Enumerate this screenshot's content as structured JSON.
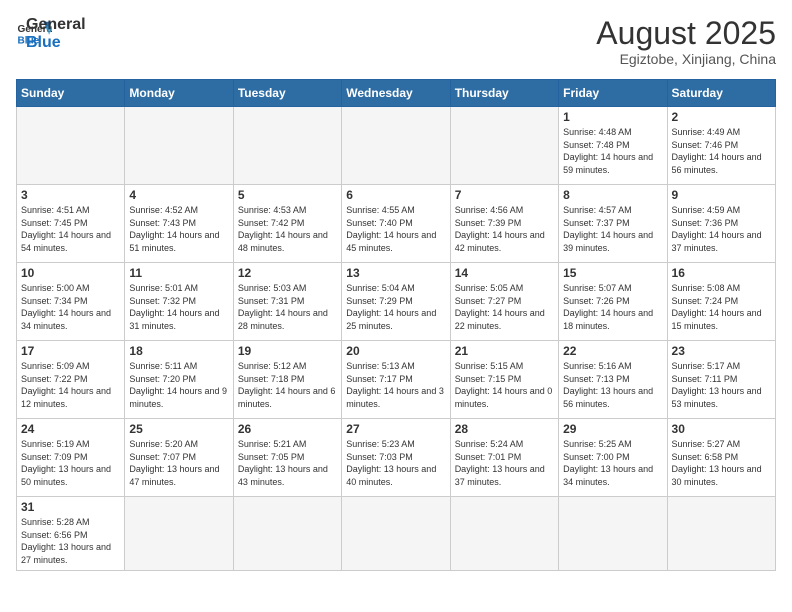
{
  "header": {
    "logo_general": "General",
    "logo_blue": "Blue",
    "title": "August 2025",
    "subtitle": "Egiztobe, Xinjiang, China"
  },
  "weekdays": [
    "Sunday",
    "Monday",
    "Tuesday",
    "Wednesday",
    "Thursday",
    "Friday",
    "Saturday"
  ],
  "weeks": [
    [
      {
        "day": "",
        "info": "",
        "empty": true
      },
      {
        "day": "",
        "info": "",
        "empty": true
      },
      {
        "day": "",
        "info": "",
        "empty": true
      },
      {
        "day": "",
        "info": "",
        "empty": true
      },
      {
        "day": "",
        "info": "",
        "empty": true
      },
      {
        "day": "1",
        "info": "Sunrise: 4:48 AM\nSunset: 7:48 PM\nDaylight: 14 hours and 59 minutes."
      },
      {
        "day": "2",
        "info": "Sunrise: 4:49 AM\nSunset: 7:46 PM\nDaylight: 14 hours and 56 minutes."
      }
    ],
    [
      {
        "day": "3",
        "info": "Sunrise: 4:51 AM\nSunset: 7:45 PM\nDaylight: 14 hours and 54 minutes."
      },
      {
        "day": "4",
        "info": "Sunrise: 4:52 AM\nSunset: 7:43 PM\nDaylight: 14 hours and 51 minutes."
      },
      {
        "day": "5",
        "info": "Sunrise: 4:53 AM\nSunset: 7:42 PM\nDaylight: 14 hours and 48 minutes."
      },
      {
        "day": "6",
        "info": "Sunrise: 4:55 AM\nSunset: 7:40 PM\nDaylight: 14 hours and 45 minutes."
      },
      {
        "day": "7",
        "info": "Sunrise: 4:56 AM\nSunset: 7:39 PM\nDaylight: 14 hours and 42 minutes."
      },
      {
        "day": "8",
        "info": "Sunrise: 4:57 AM\nSunset: 7:37 PM\nDaylight: 14 hours and 39 minutes."
      },
      {
        "day": "9",
        "info": "Sunrise: 4:59 AM\nSunset: 7:36 PM\nDaylight: 14 hours and 37 minutes."
      }
    ],
    [
      {
        "day": "10",
        "info": "Sunrise: 5:00 AM\nSunset: 7:34 PM\nDaylight: 14 hours and 34 minutes."
      },
      {
        "day": "11",
        "info": "Sunrise: 5:01 AM\nSunset: 7:32 PM\nDaylight: 14 hours and 31 minutes."
      },
      {
        "day": "12",
        "info": "Sunrise: 5:03 AM\nSunset: 7:31 PM\nDaylight: 14 hours and 28 minutes."
      },
      {
        "day": "13",
        "info": "Sunrise: 5:04 AM\nSunset: 7:29 PM\nDaylight: 14 hours and 25 minutes."
      },
      {
        "day": "14",
        "info": "Sunrise: 5:05 AM\nSunset: 7:27 PM\nDaylight: 14 hours and 22 minutes."
      },
      {
        "day": "15",
        "info": "Sunrise: 5:07 AM\nSunset: 7:26 PM\nDaylight: 14 hours and 18 minutes."
      },
      {
        "day": "16",
        "info": "Sunrise: 5:08 AM\nSunset: 7:24 PM\nDaylight: 14 hours and 15 minutes."
      }
    ],
    [
      {
        "day": "17",
        "info": "Sunrise: 5:09 AM\nSunset: 7:22 PM\nDaylight: 14 hours and 12 minutes."
      },
      {
        "day": "18",
        "info": "Sunrise: 5:11 AM\nSunset: 7:20 PM\nDaylight: 14 hours and 9 minutes."
      },
      {
        "day": "19",
        "info": "Sunrise: 5:12 AM\nSunset: 7:18 PM\nDaylight: 14 hours and 6 minutes."
      },
      {
        "day": "20",
        "info": "Sunrise: 5:13 AM\nSunset: 7:17 PM\nDaylight: 14 hours and 3 minutes."
      },
      {
        "day": "21",
        "info": "Sunrise: 5:15 AM\nSunset: 7:15 PM\nDaylight: 14 hours and 0 minutes."
      },
      {
        "day": "22",
        "info": "Sunrise: 5:16 AM\nSunset: 7:13 PM\nDaylight: 13 hours and 56 minutes."
      },
      {
        "day": "23",
        "info": "Sunrise: 5:17 AM\nSunset: 7:11 PM\nDaylight: 13 hours and 53 minutes."
      }
    ],
    [
      {
        "day": "24",
        "info": "Sunrise: 5:19 AM\nSunset: 7:09 PM\nDaylight: 13 hours and 50 minutes."
      },
      {
        "day": "25",
        "info": "Sunrise: 5:20 AM\nSunset: 7:07 PM\nDaylight: 13 hours and 47 minutes."
      },
      {
        "day": "26",
        "info": "Sunrise: 5:21 AM\nSunset: 7:05 PM\nDaylight: 13 hours and 43 minutes."
      },
      {
        "day": "27",
        "info": "Sunrise: 5:23 AM\nSunset: 7:03 PM\nDaylight: 13 hours and 40 minutes."
      },
      {
        "day": "28",
        "info": "Sunrise: 5:24 AM\nSunset: 7:01 PM\nDaylight: 13 hours and 37 minutes."
      },
      {
        "day": "29",
        "info": "Sunrise: 5:25 AM\nSunset: 7:00 PM\nDaylight: 13 hours and 34 minutes."
      },
      {
        "day": "30",
        "info": "Sunrise: 5:27 AM\nSunset: 6:58 PM\nDaylight: 13 hours and 30 minutes."
      }
    ],
    [
      {
        "day": "31",
        "info": "Sunrise: 5:28 AM\nSunset: 6:56 PM\nDaylight: 13 hours and 27 minutes.",
        "last": true
      },
      {
        "day": "",
        "info": "",
        "empty": true,
        "last": true
      },
      {
        "day": "",
        "info": "",
        "empty": true,
        "last": true
      },
      {
        "day": "",
        "info": "",
        "empty": true,
        "last": true
      },
      {
        "day": "",
        "info": "",
        "empty": true,
        "last": true
      },
      {
        "day": "",
        "info": "",
        "empty": true,
        "last": true
      },
      {
        "day": "",
        "info": "",
        "empty": true,
        "last": true
      }
    ]
  ]
}
